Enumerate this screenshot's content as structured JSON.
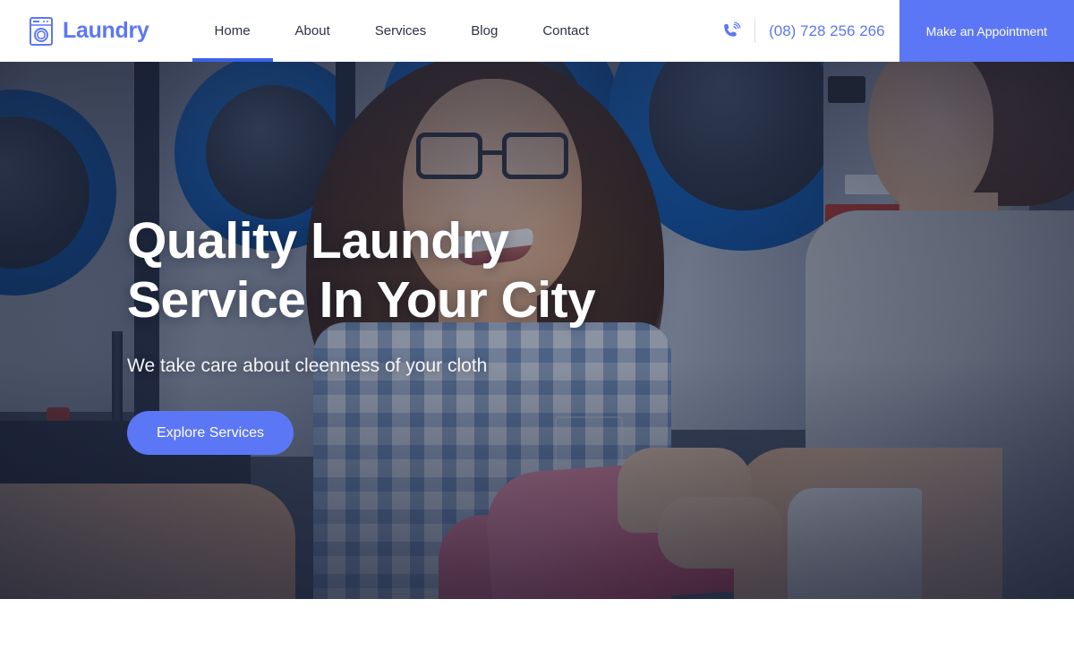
{
  "brand": {
    "name": "Laundry",
    "logo_icon": "washing-machine-icon",
    "color": "#5c77f5"
  },
  "nav": {
    "items": [
      {
        "label": "Home",
        "active": true
      },
      {
        "label": "About",
        "active": false
      },
      {
        "label": "Services",
        "active": false
      },
      {
        "label": "Blog",
        "active": false
      },
      {
        "label": "Contact",
        "active": false
      }
    ],
    "active_indicator_color": "#3b63e8"
  },
  "header": {
    "phone_icon": "phone-ringing-icon",
    "phone_number": "(08) 728 256 266",
    "appointment_label": "Make an Appointment",
    "appointment_bg": "#5c77f5"
  },
  "hero": {
    "title_line_1": "Quality Laundry",
    "title_line_2": "Service In Your City",
    "subtitle": "We take care about cleenness of your cloth",
    "cta_label": "Explore Services",
    "cta_color": "#5c77f5",
    "background": "laundromat-photo-two-women-exchanging-pink-garment"
  }
}
